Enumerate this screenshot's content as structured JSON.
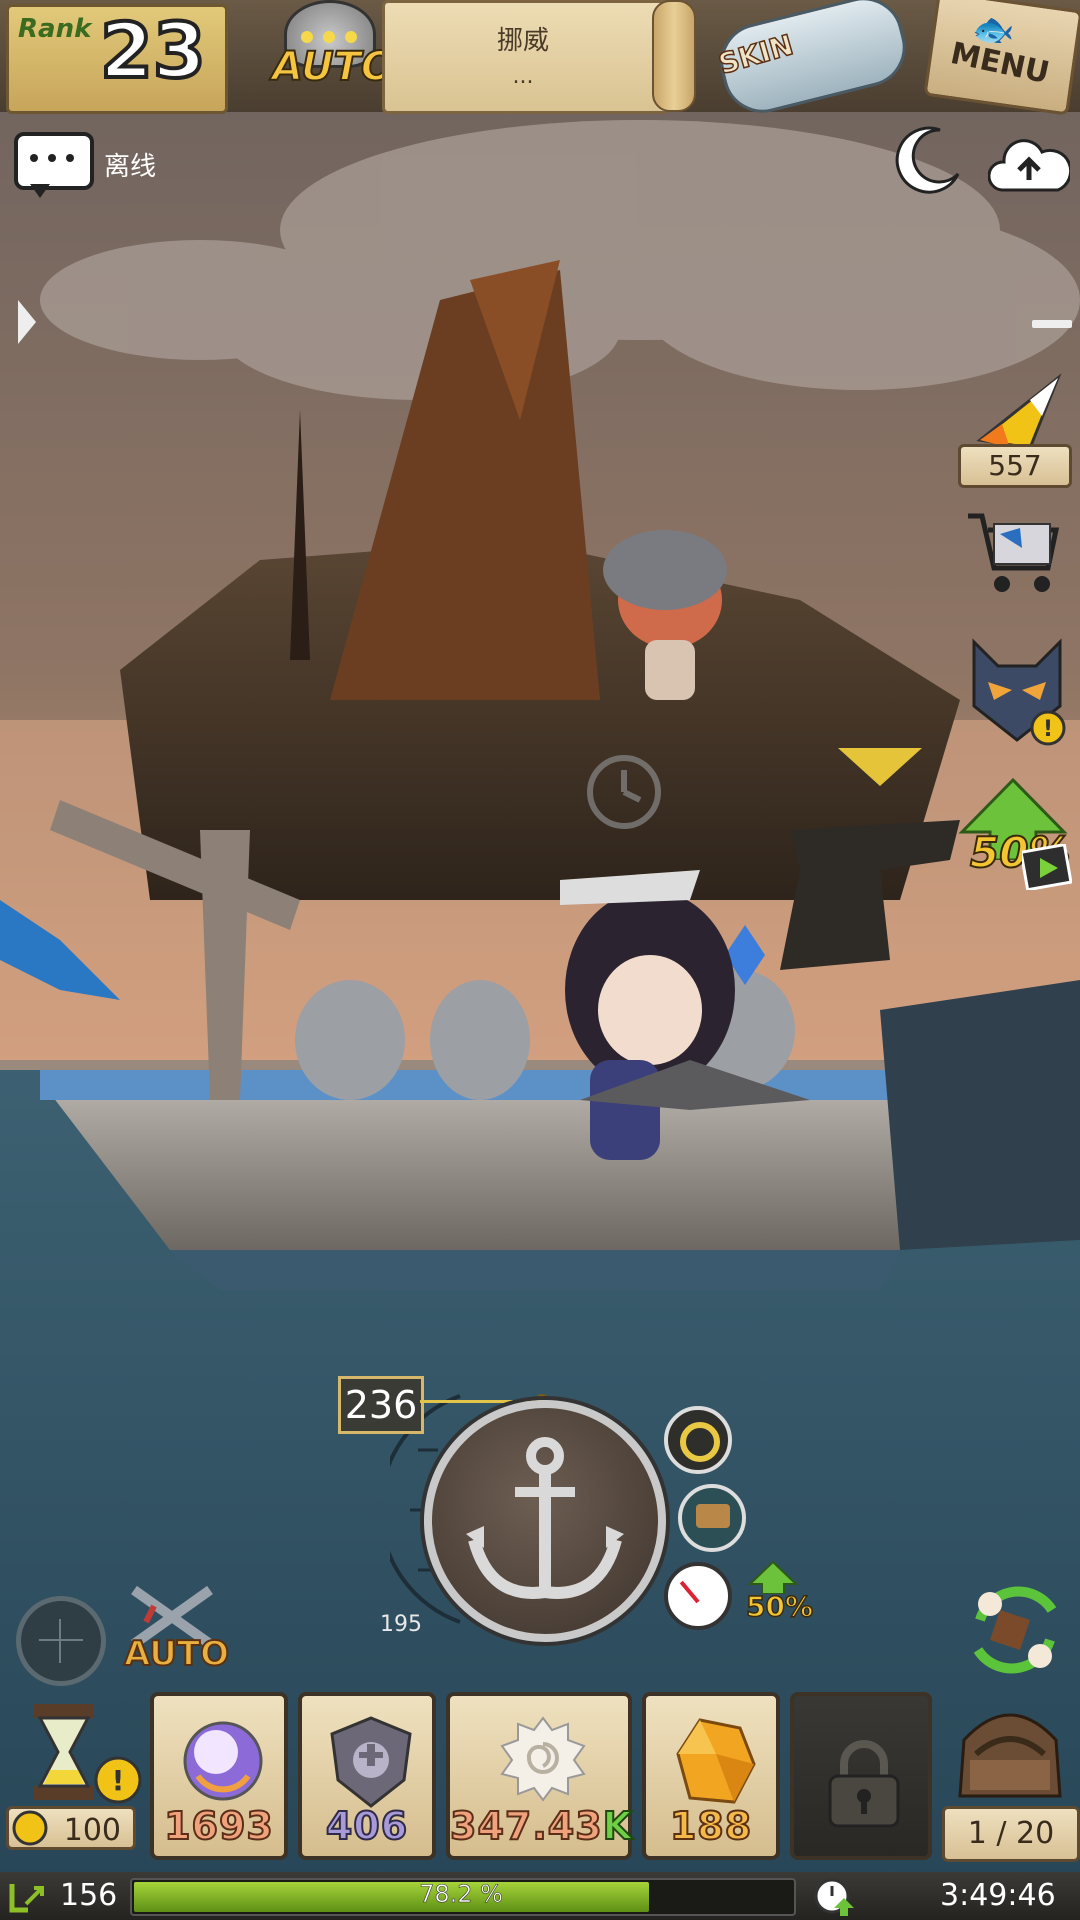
{
  "topbar": {
    "rank_label": "Rank",
    "rank_value": "23",
    "auto_label": "AUTO",
    "location_name": "挪威",
    "location_sub": "...",
    "skin_label": "SKIN",
    "menu_label": "MENU"
  },
  "chat": {
    "status": "离线"
  },
  "right_column": {
    "candy_count": "557",
    "boost_percent": "50%"
  },
  "cast": {
    "depth_value": "236",
    "depth_min": "195",
    "boost_percent": "50%"
  },
  "auto_bottom_label": "AUTO",
  "hourglass_count": "100",
  "inventory": {
    "slots": [
      {
        "icon": "pearl-orb-icon",
        "value": "1693",
        "color": "#f0a27d"
      },
      {
        "icon": "skull-shield-icon",
        "value": "406",
        "color": "#a89ad8"
      },
      {
        "icon": "spiral-shell-icon",
        "value": "347.43",
        "suffix": "K",
        "color": "#f0a27d",
        "suffix_color": "#6fd046"
      },
      {
        "icon": "amber-gem-icon",
        "value": "188",
        "color": "#f0a27d"
      },
      {
        "icon": "lock-icon",
        "value": ""
      }
    ],
    "bag_count": "1 / 20"
  },
  "status_bar": {
    "level": "156",
    "xp_text": "78.2 %",
    "xp_fraction": 0.782,
    "time": "3:49:46"
  },
  "colors": {
    "sky_top": "#7d6d62",
    "sky_bottom": "#d9a97f",
    "sea": "#2c4a5c",
    "accent_yellow": "#f3c533",
    "xp_green": "#8dc026"
  }
}
